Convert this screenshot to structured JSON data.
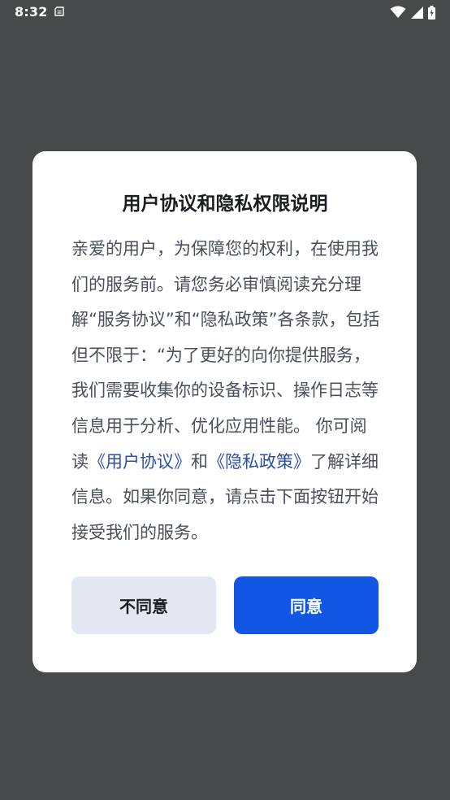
{
  "status_bar": {
    "time": "8:32",
    "icons": [
      "notification-icon",
      "wifi-icon",
      "signal-icon",
      "battery-icon"
    ]
  },
  "dialog": {
    "title": "用户协议和隐私权限说明",
    "body_before_links": "亲爱的用户，为保障您的权利，在使用我们的服务前。请您务必审慎阅读充分理解“服务协议”和“隐私政策”各条款，包括但不限于：“为了更好的向你提供服务，我们需要收集你的设备标识、操作日志等信息用于分析、优化应用性能。 你可阅读",
    "link_user_agreement": "《用户协议》",
    "conjunction": "和",
    "link_privacy_policy": "《隐私政策》",
    "body_after_links": "了解详细信息。如果你同意，请点击下面按钮开始接受我们的服务。",
    "disagree_label": "不同意",
    "agree_label": "同意"
  },
  "colors": {
    "overlay_background": "#48494b",
    "dialog_background": "#ffffff",
    "title_text": "#1b1d22",
    "body_text": "#4a4f5b",
    "link_text": "#2d4fa6",
    "disagree_button_bg": "#e3e7f1",
    "agree_button_bg": "#1157e4"
  }
}
